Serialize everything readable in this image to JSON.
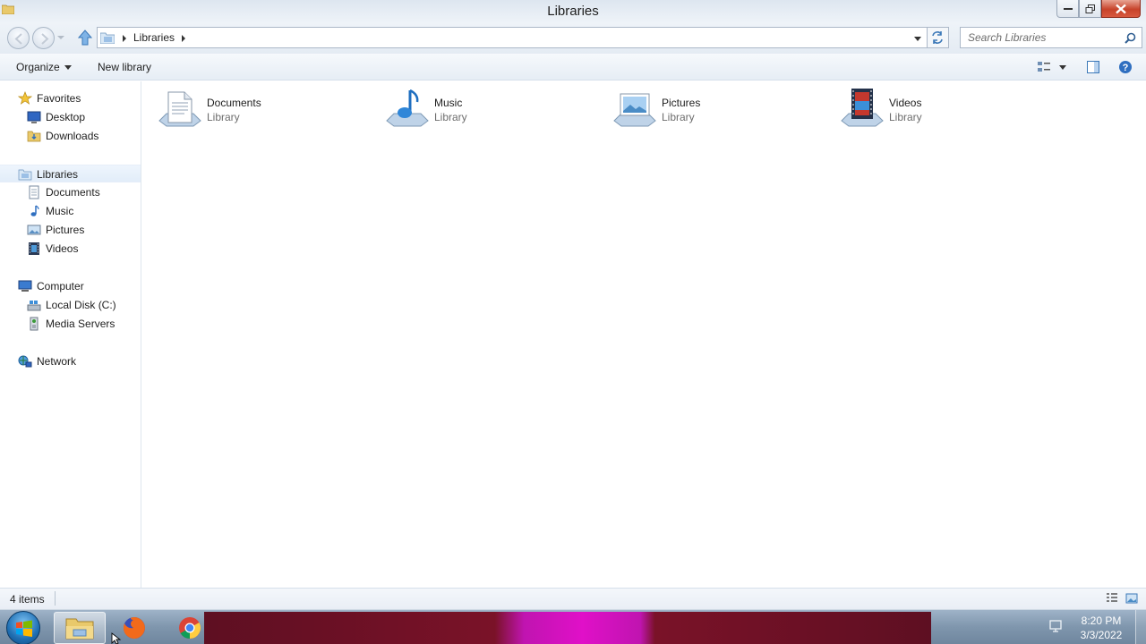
{
  "window": {
    "title": "Libraries",
    "controls": [
      "minimize",
      "maximize",
      "close"
    ]
  },
  "address_bar": {
    "breadcrumb": [
      "Libraries"
    ],
    "icons": [
      "back-icon",
      "forward-icon",
      "up-arrow-icon",
      "folder-icon",
      "refresh-icon"
    ]
  },
  "search": {
    "placeholder": "Search Libraries",
    "icon": "magnifier-icon"
  },
  "toolbar": {
    "organize_label": "Organize",
    "new_library_label": "New library",
    "right_icons": [
      "change-view-icon",
      "preview-pane-icon",
      "help-icon"
    ]
  },
  "navigation": {
    "favorites": {
      "label": "Favorites",
      "items": [
        {
          "label": "Desktop",
          "icon": "desktop-icon"
        },
        {
          "label": "Downloads",
          "icon": "downloads-folder-icon"
        }
      ]
    },
    "libraries": {
      "label": "Libraries",
      "selected": true,
      "items": [
        {
          "label": "Documents",
          "icon": "documents-icon"
        },
        {
          "label": "Music",
          "icon": "music-note-icon"
        },
        {
          "label": "Pictures",
          "icon": "pictures-icon"
        },
        {
          "label": "Videos",
          "icon": "film-icon"
        }
      ]
    },
    "computer": {
      "label": "Computer",
      "items": [
        {
          "label": "Local Disk (C:)",
          "icon": "disk-drive-icon"
        },
        {
          "label": "Media Servers",
          "icon": "media-server-icon"
        }
      ]
    },
    "network": {
      "label": "Network"
    }
  },
  "libraries": [
    {
      "name": "Documents",
      "type": "Library",
      "icon": "documents-library-icon"
    },
    {
      "name": "Music",
      "type": "Library",
      "icon": "music-library-icon"
    },
    {
      "name": "Pictures",
      "type": "Library",
      "icon": "pictures-library-icon"
    },
    {
      "name": "Videos",
      "type": "Library",
      "icon": "videos-library-icon"
    }
  ],
  "status_bar": {
    "item_count": "4 items",
    "view_icons": [
      "details-view-icon",
      "large-icons-view-icon"
    ]
  },
  "taskbar": {
    "pinned": [
      "windows-explorer",
      "firefox",
      "chrome"
    ],
    "time": "8:20 PM",
    "date": "3/3/2022"
  },
  "colors": {
    "selection": "#e2edf9",
    "taskbar": "#7f96ad",
    "close_button": "#c7432a",
    "secondary_text": "#6d6d6d"
  }
}
